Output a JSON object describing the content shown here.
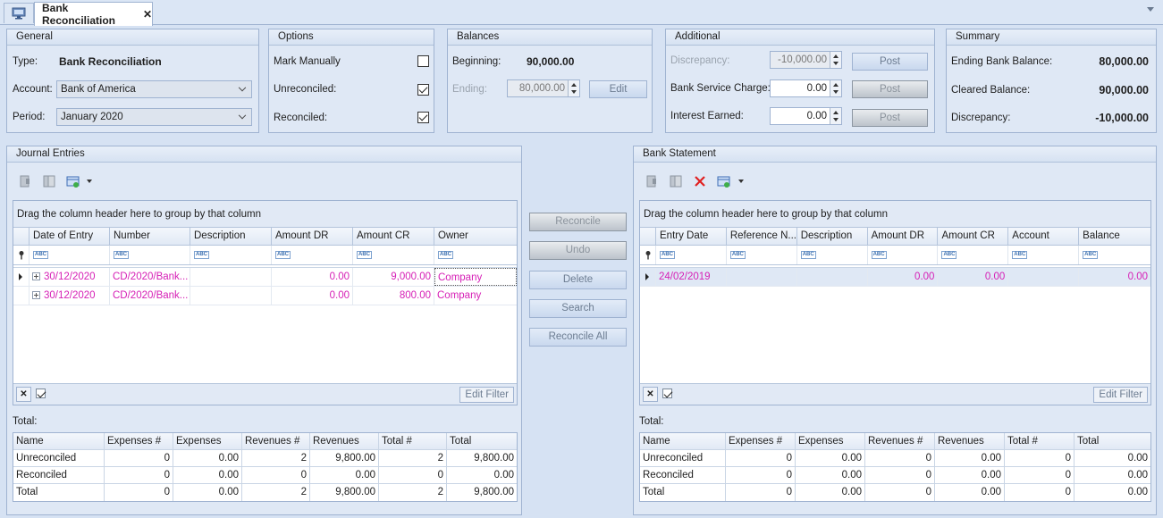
{
  "tab": {
    "title": "Bank Reconciliation"
  },
  "general": {
    "title": "General",
    "type_label": "Type:",
    "type_value": "Bank Reconciliation",
    "account_label": "Account:",
    "account_value": "Bank of America",
    "period_label": "Period:",
    "period_value": "January 2020"
  },
  "options": {
    "title": "Options",
    "mark_manually": "Mark Manually",
    "unreconciled": "Unreconciled:",
    "reconciled": "Reconciled:",
    "mark_manually_checked": false,
    "unreconciled_checked": true,
    "reconciled_checked": true
  },
  "balances": {
    "title": "Balances",
    "beginning_label": "Beginning:",
    "beginning_value": "90,000.00",
    "ending_label": "Ending:",
    "ending_value": "80,000.00",
    "edit_button": "Edit"
  },
  "additional": {
    "title": "Additional",
    "discrepancy_label": "Discrepancy:",
    "discrepancy_value": "-10,000.00",
    "service_label": "Bank Service Charge:",
    "service_value": "0.00",
    "interest_label": "Interest Earned:",
    "interest_value": "0.00",
    "post_button": "Post"
  },
  "summary": {
    "title": "Summary",
    "ending_label": "Ending Bank Balance:",
    "ending_value": "80,000.00",
    "cleared_label": "Cleared Balance:",
    "cleared_value": "90,000.00",
    "discrepancy_label": "Discrepancy:",
    "discrepancy_value": "-10,000.00"
  },
  "group_hint": "Drag the column header here to group by that column",
  "edit_filter": "Edit Filter",
  "total_label": "Total:",
  "journal": {
    "title": "Journal Entries",
    "columns": [
      "Date of Entry",
      "Number",
      "Description",
      "Amount DR",
      "Amount CR",
      "Owner"
    ],
    "rows": [
      [
        "30/12/2020",
        "CD/2020/Bank...",
        "",
        "0.00",
        "9,000.00",
        "Company"
      ],
      [
        "30/12/2020",
        "CD/2020/Bank...",
        "",
        "0.00",
        "800.00",
        "Company"
      ]
    ]
  },
  "statement": {
    "title": "Bank Statement",
    "columns": [
      "Entry Date",
      "Reference N...",
      "Description",
      "Amount DR",
      "Amount CR",
      "Account",
      "Balance"
    ],
    "rows": [
      [
        "24/02/2019",
        "",
        "",
        "0.00",
        "0.00",
        "",
        "0.00"
      ]
    ]
  },
  "actions": {
    "reconcile": "Reconcile",
    "undo": "Undo",
    "delete": "Delete",
    "search": "Search",
    "reconcile_all": "Reconcile All"
  },
  "totals_columns": [
    "Name",
    "Expenses #",
    "Expenses",
    "Revenues #",
    "Revenues",
    "Total #",
    "Total"
  ],
  "journal_totals": [
    [
      "Unreconciled",
      "0",
      "0.00",
      "2",
      "9,800.00",
      "2",
      "9,800.00"
    ],
    [
      "Reconciled",
      "0",
      "0.00",
      "0",
      "0.00",
      "0",
      "0.00"
    ],
    [
      "Total",
      "0",
      "0.00",
      "2",
      "9,800.00",
      "2",
      "9,800.00"
    ]
  ],
  "statement_totals": [
    [
      "Unreconciled",
      "0",
      "0.00",
      "0",
      "0.00",
      "0",
      "0.00"
    ],
    [
      "Reconciled",
      "0",
      "0.00",
      "0",
      "0.00",
      "0",
      "0.00"
    ],
    [
      "Total",
      "0",
      "0.00",
      "0",
      "0.00",
      "0",
      "0.00"
    ]
  ]
}
